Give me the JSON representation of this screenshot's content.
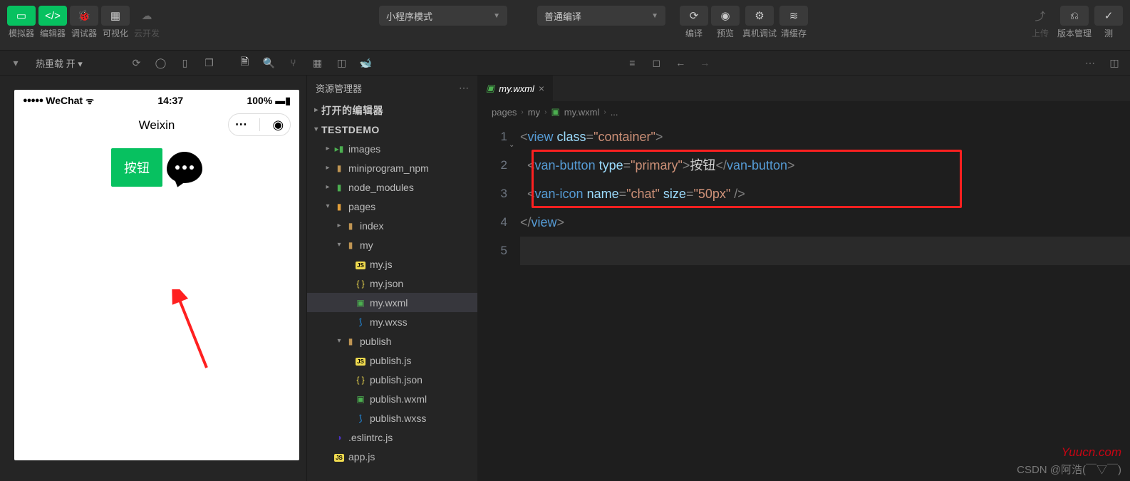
{
  "toolbar": {
    "groups": {
      "simulator": "模拟器",
      "editor": "编辑器",
      "debugger": "调试器",
      "visualize": "可视化",
      "cloud": "云开发"
    },
    "mode_select": "小程序模式",
    "compile_select": "普通编译",
    "actions": {
      "compile": "编译",
      "preview": "预览",
      "realdevice": "真机调试",
      "clearcache": "清缓存",
      "upload": "上传",
      "version": "版本管理",
      "test": "测"
    }
  },
  "subbar": {
    "hot_reload": "热重载 开"
  },
  "simulator": {
    "carrier": "WeChat",
    "time": "14:37",
    "battery": "100%",
    "title": "Weixin",
    "button_label": "按钮"
  },
  "explorer": {
    "title": "资源管理器",
    "section_open_editors": "打开的编辑器",
    "project_name": "TESTDEMO",
    "tree": {
      "images": "images",
      "miniprogram_npm": "miniprogram_npm",
      "node_modules": "node_modules",
      "pages": "pages",
      "index": "index",
      "my": "my",
      "my_js": "my.js",
      "my_json": "my.json",
      "my_wxml": "my.wxml",
      "my_wxss": "my.wxss",
      "publish": "publish",
      "publish_js": "publish.js",
      "publish_json": "publish.json",
      "publish_wxml": "publish.wxml",
      "publish_wxss": "publish.wxss",
      "eslintrc": ".eslintrc.js",
      "app_js": "app.js"
    }
  },
  "editor": {
    "tab_label": "my.wxml",
    "breadcrumb": {
      "p1": "pages",
      "p2": "my",
      "p3": "my.wxml",
      "p4": "..."
    },
    "code": {
      "l1_a": "<",
      "l1_b": "view",
      "l1_c": " class",
      "l1_d": "=",
      "l1_e": "\"container\"",
      "l1_f": ">",
      "l2_a": "  <",
      "l2_b": "van-button",
      "l2_c": " type",
      "l2_d": "=",
      "l2_e": "\"primary\"",
      "l2_f": ">",
      "l2_g": "按钮",
      "l2_h": "</",
      "l2_i": "van-button",
      "l2_j": ">",
      "l3_a": "  <",
      "l3_b": "van-icon",
      "l3_c": " name",
      "l3_d": "=",
      "l3_e": "\"chat\"",
      "l3_f": " size",
      "l3_g": "=",
      "l3_h": "\"50px\"",
      "l3_i": " />",
      "l4_a": "</",
      "l4_b": "view",
      "l4_c": ">"
    },
    "line_numbers": [
      "1",
      "2",
      "3",
      "4",
      "5"
    ]
  },
  "watermark": {
    "w1": "Yuucn.com",
    "w2": "CSDN @阿浩(￣▽￣)"
  }
}
